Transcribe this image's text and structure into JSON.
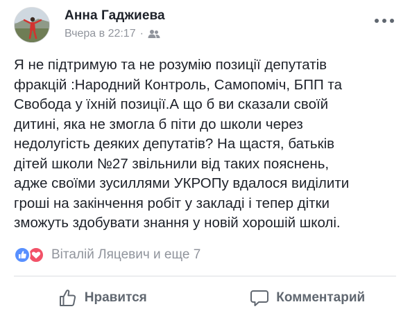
{
  "post": {
    "author": "Анна Гаджиева",
    "timestamp": "Вчера в 22:17",
    "separator": "·",
    "audience_icon": "friends-icon",
    "menu_icon": "more-horizontal-icon",
    "text": "Я не підтримую та не розумію позиції депутатів\nфракцій :Народний Контроль, Самопоміч, БПП та\nСвобода у їхній позиції.А що б ви сказали своїй\nдитині, яка не змогла б піти до школи через\nнедолугість деяких депутатів? На щастя, батьків\nдітей школи №27 звільнили від таких пояснень,\nадже своїми зусиллями УКРОПу вдалося виділити\nгроші на закінчення робіт у закладі і тепер дітки\nзможуть здобувати знання у новій хорошій школі."
  },
  "reactions": {
    "icons": [
      "like-reaction-icon",
      "love-reaction-icon"
    ],
    "summary": "Віталій Ляцевич и еще 7"
  },
  "actions": {
    "like_label": "Нравится",
    "comment_label": "Комментарий"
  },
  "colors": {
    "like_blue": "#5890ff",
    "love_red": "#f25268",
    "meta_gray": "#90949c",
    "action_gray": "#606770",
    "text": "#1d2129"
  }
}
